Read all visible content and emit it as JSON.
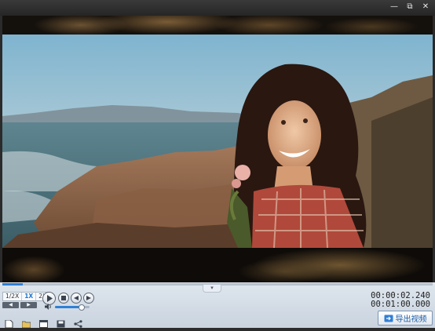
{
  "window": {
    "minimize_glyph": "—",
    "restore_glyph": "⧉",
    "close_glyph": "✕"
  },
  "video": {
    "playback_progress": 0.048
  },
  "controls": {
    "speed_options": [
      "1/2X",
      "1X",
      "2X"
    ],
    "selected_speed": "1X",
    "frame_back_glyph": "◀",
    "frame_forward_glyph": "▶",
    "volume_level": 0.74,
    "buttons": [
      "play-icon",
      "stop-icon",
      "previous-icon",
      "next-icon"
    ]
  },
  "toolbar": {
    "icons": [
      "new-file-icon",
      "open-folder-icon",
      "window-icon",
      "save-icon",
      "share-icon"
    ]
  },
  "time": {
    "current": "00:00:02.240",
    "total": "00:01:00.000"
  },
  "export": {
    "label": "导出视频"
  },
  "colors": {
    "accent": "#2f7fd6",
    "panel": "#d3dbe5",
    "titlebar": "#2f2f2f"
  }
}
